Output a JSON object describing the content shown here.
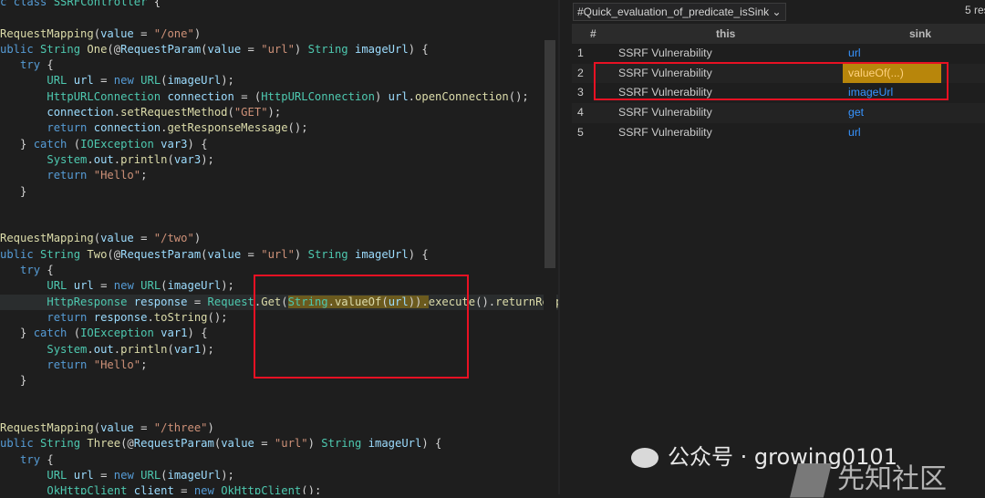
{
  "editor": {
    "lines": [
      "c class SSRFController {",
      "",
      "RequestMapping(value = \"/one\")",
      "ublic String One(@RequestParam(value = \"url\") String imageUrl) {",
      "   try {",
      "       URL url = new URL(imageUrl);",
      "       HttpURLConnection connection = (HttpURLConnection) url.openConnection();",
      "       connection.setRequestMethod(\"GET\");",
      "       return connection.getResponseMessage();",
      "   } catch (IOException var3) {",
      "       System.out.println(var3);",
      "       return \"Hello\";",
      "   }",
      "",
      "",
      "RequestMapping(value = \"/two\")",
      "ublic String Two(@RequestParam(value = \"url\") String imageUrl) {",
      "   try {",
      "       URL url = new URL(imageUrl);",
      "       HttpResponse response = Request.Get(String.valueOf(url)).execute().returnResponse",
      "       return response.toString();",
      "   } catch (IOException var1) {",
      "       System.out.println(var1);",
      "       return \"Hello\";",
      "   }",
      "",
      "",
      "RequestMapping(value = \"/three\")",
      "ublic String Three(@RequestParam(value = \"url\") String imageUrl) {",
      "   try {",
      "       URL url = new URL(imageUrl);",
      "       OkHttpClient client = new OkHttpClient();"
    ]
  },
  "results": {
    "query_name": "#Quick_evaluation_of_predicate_isSink",
    "result_count": "5 res",
    "columns": [
      "#",
      "this",
      "sink"
    ],
    "rows": [
      {
        "num": "1",
        "this": "SSRF Vulnerability",
        "sink": "url"
      },
      {
        "num": "2",
        "this": "SSRF Vulnerability",
        "sink": "valueOf(...)"
      },
      {
        "num": "3",
        "this": "SSRF Vulnerability",
        "sink": "imageUrl"
      },
      {
        "num": "4",
        "this": "SSRF Vulnerability",
        "sink": "get"
      },
      {
        "num": "5",
        "this": "SSRF Vulnerability",
        "sink": "url"
      }
    ],
    "selected_row": "2"
  },
  "watermark": {
    "text": "公众号 · growing0101",
    "logo_text": "先知社区"
  },
  "colors": {
    "accent_red": "#e81123",
    "selection": "#b8860b",
    "link": "#3794ff"
  }
}
